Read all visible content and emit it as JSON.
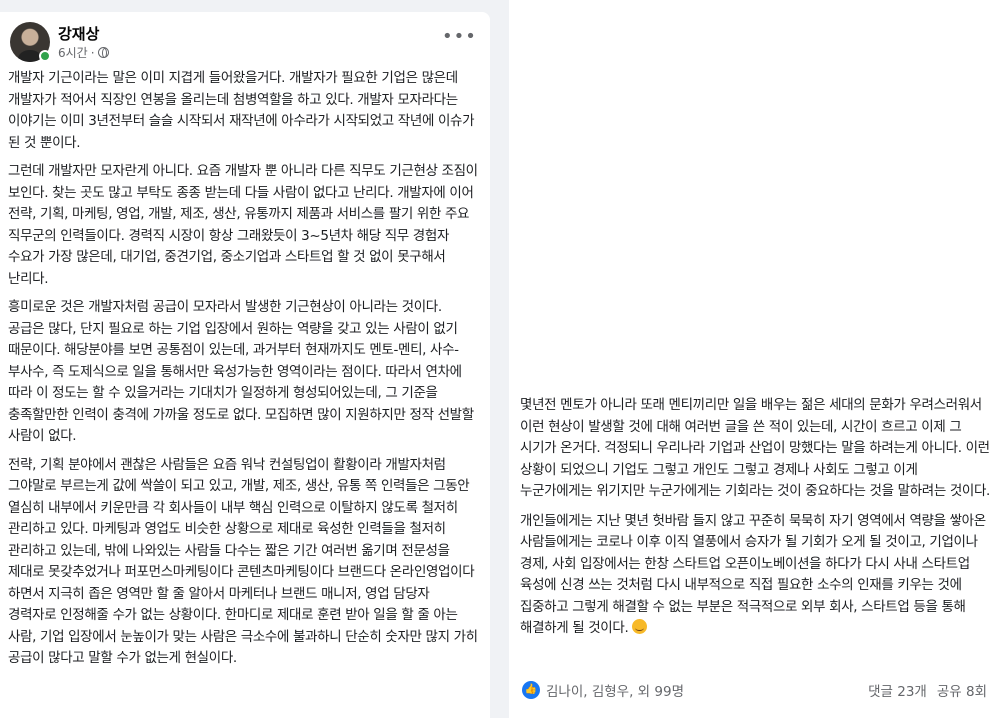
{
  "post": {
    "author": "강재상",
    "time": "6시간",
    "separator": "·",
    "more_label": "•••",
    "paragraphs": [
      "개발자 기근이라는 말은 이미 지겹게 들어왔을거다. 개발자가 필요한 기업은 많은데 개발자가 적어서 직장인 연봉을 올리는데 첨병역할을 하고 있다. 개발자 모자라다는 이야기는 이미 3년전부터 슬슬 시작되서 재작년에 아수라가 시작되었고 작년에 이슈가 된 것 뿐이다.",
      "그런데 개발자만 모자란게 아니다. 요즘 개발자 뿐 아니라 다른 직무도 기근현상 조짐이 보인다. 찾는 곳도 많고 부탁도 종종 받는데 다들 사람이 없다고 난리다. 개발자에 이어 전략, 기획, 마케팅, 영업, 개발, 제조, 생산, 유통까지 제품과 서비스를 팔기 위한 주요 직무군의 인력들이다. 경력직 시장이 항상 그래왔듯이 3~5년차 해당 직무 경험자 수요가 가장 많은데, 대기업, 중견기업, 중소기업과 스타트업 할 것 없이 못구해서 난리다.",
      "흥미로운 것은 개발자처럼 공급이 모자라서 발생한 기근현상이 아니라는 것이다. 공급은 많다, 단지 필요로 하는 기업 입장에서 원하는 역량을 갖고 있는 사람이 없기 때문이다. 해당분야를 보면 공통점이 있는데, 과거부터 현재까지도 멘토-멘티, 사수-부사수, 즉 도제식으로 일을 통해서만 육성가능한 영역이라는 점이다. 따라서 연차에 따라 이 정도는 할 수 있을거라는 기대치가 일정하게 형성되어있는데, 그 기준을 충족할만한 인력이 충격에 가까울 정도로 없다. 모집하면 많이 지원하지만 정작 선발할 사람이 없다.",
      "전략, 기획 분야에서 괜찮은 사람들은 요즘 워낙 컨설팅업이 활황이라 개발자처럼 그야말로 부르는게 값에 싹쓸이 되고 있고, 개발, 제조, 생산, 유통 쪽 인력들은 그동안 열심히 내부에서 키운만큼 각 회사들이 내부 핵심 인력으로 이탈하지 않도록 철저히 관리하고 있다. 마케팅과 영업도 비슷한 상황으로 제대로 육성한 인력들을 철저히 관리하고 있는데, 밖에 나와있는 사람들 다수는 짧은 기간 여러번 옮기며 전문성을 제대로 못갖추었거나 퍼포먼스마케팅이다 콘텐츠마케팅이다 브랜드다 온라인영업이다 하면서 지극히 좁은 영역만 할 줄 알아서 마케터나 브랜드 매니저, 영업 담당자 경력자로 인정해줄 수가 없는 상황이다. 한마디로 제대로 훈련 받아 일을 할 줄 아는 사람, 기업 입장에서 눈높이가 맞는 사람은 극소수에 불과하니 단순히 숫자만 많지 가히 공급이 많다고 말할 수가 없는게 현실이다."
    ]
  },
  "continuation": {
    "paragraphs": [
      "몇년전 멘토가 아니라 또래 멘티끼리만 일을 배우는 젊은 세대의 문화가 우려스러워서 이런 현상이 발생할 것에 대해 여러번 글을 쓴 적이 있는데, 시간이 흐르고 이제 그 시기가 온거다. 걱정되니 우리나라 기업과 산업이 망했다는 말을 하려는게 아니다. 이런 상황이 되었으니 기업도 그렇고 개인도 그렇고 경제나 사회도 그렇고 이게 누군가에게는 위기지만 누군가에게는 기회라는 것이 중요하다는 것을 말하려는 것이다.",
      "개인들에게는 지난 몇년 헛바람 들지 않고 꾸준히 묵묵히 자기 영역에서 역량을 쌓아온 사람들에게는 코로나 이후 이직 열풍에서 승자가 될 기회가 오게 될 것이고, 기업이나 경제, 사회 입장에서는 한창 스타트업 오픈이노베이션을 하다가 다시 사내 스타트업 육성에 신경 쓰는 것처럼 다시 내부적으로 직접 필요한 소수의 인재를 키우는 것에 집중하고 그렇게 해결할 수 없는 부분은 적극적으로 외부 회사, 스타트업 등을 통해 해결하게 될 것이다."
    ],
    "emoji": "smiling-face-emoji"
  },
  "footer": {
    "like_symbol": "👍",
    "reactors": "김나이, 김형우, 외 99명",
    "comments": "댓글 23개",
    "shares": "공유 8회"
  },
  "colors": {
    "background": "#f0f2f5",
    "card": "#ffffff",
    "muted_text": "#65676b",
    "like_blue": "#1877f2",
    "online_green": "#31a24c"
  }
}
